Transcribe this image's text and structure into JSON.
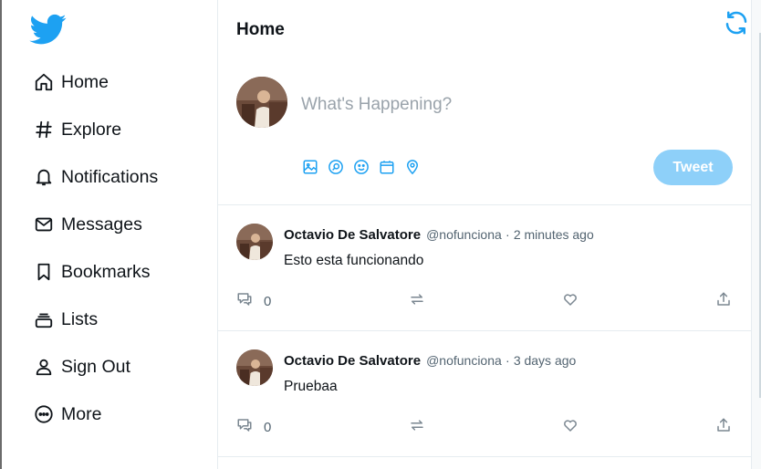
{
  "colors": {
    "accent": "#1da1f2",
    "tweet_button_bg": "#8ed0f9",
    "muted": "#536471"
  },
  "sidebar": {
    "logo_icon": "twitter-bird-icon",
    "items": [
      {
        "label": "Home",
        "icon": "home-icon"
      },
      {
        "label": "Explore",
        "icon": "hashtag-icon"
      },
      {
        "label": "Notifications",
        "icon": "bell-icon"
      },
      {
        "label": "Messages",
        "icon": "envelope-icon"
      },
      {
        "label": "Bookmarks",
        "icon": "bookmark-icon"
      },
      {
        "label": "Lists",
        "icon": "list-icon"
      },
      {
        "label": "Sign Out",
        "icon": "user-icon"
      },
      {
        "label": "More",
        "icon": "more-circle-icon"
      }
    ]
  },
  "main": {
    "title": "Home",
    "refresh_icon": "refresh-icon",
    "compose": {
      "placeholder": "What's Happening?",
      "value": "",
      "tools": [
        "image-icon",
        "gif-search-icon",
        "emoji-icon",
        "schedule-icon",
        "location-icon"
      ],
      "tweet_label": "Tweet"
    },
    "tweets": [
      {
        "name": "Octavio De Salvatore",
        "handle": "@nofunciona",
        "separator": "·",
        "time": "2 minutes ago",
        "text": "Esto esta funcionando",
        "reply_count": "0"
      },
      {
        "name": "Octavio De Salvatore",
        "handle": "@nofunciona",
        "separator": "·",
        "time": "3 days ago",
        "text": "Pruebaa",
        "reply_count": "0"
      }
    ]
  }
}
